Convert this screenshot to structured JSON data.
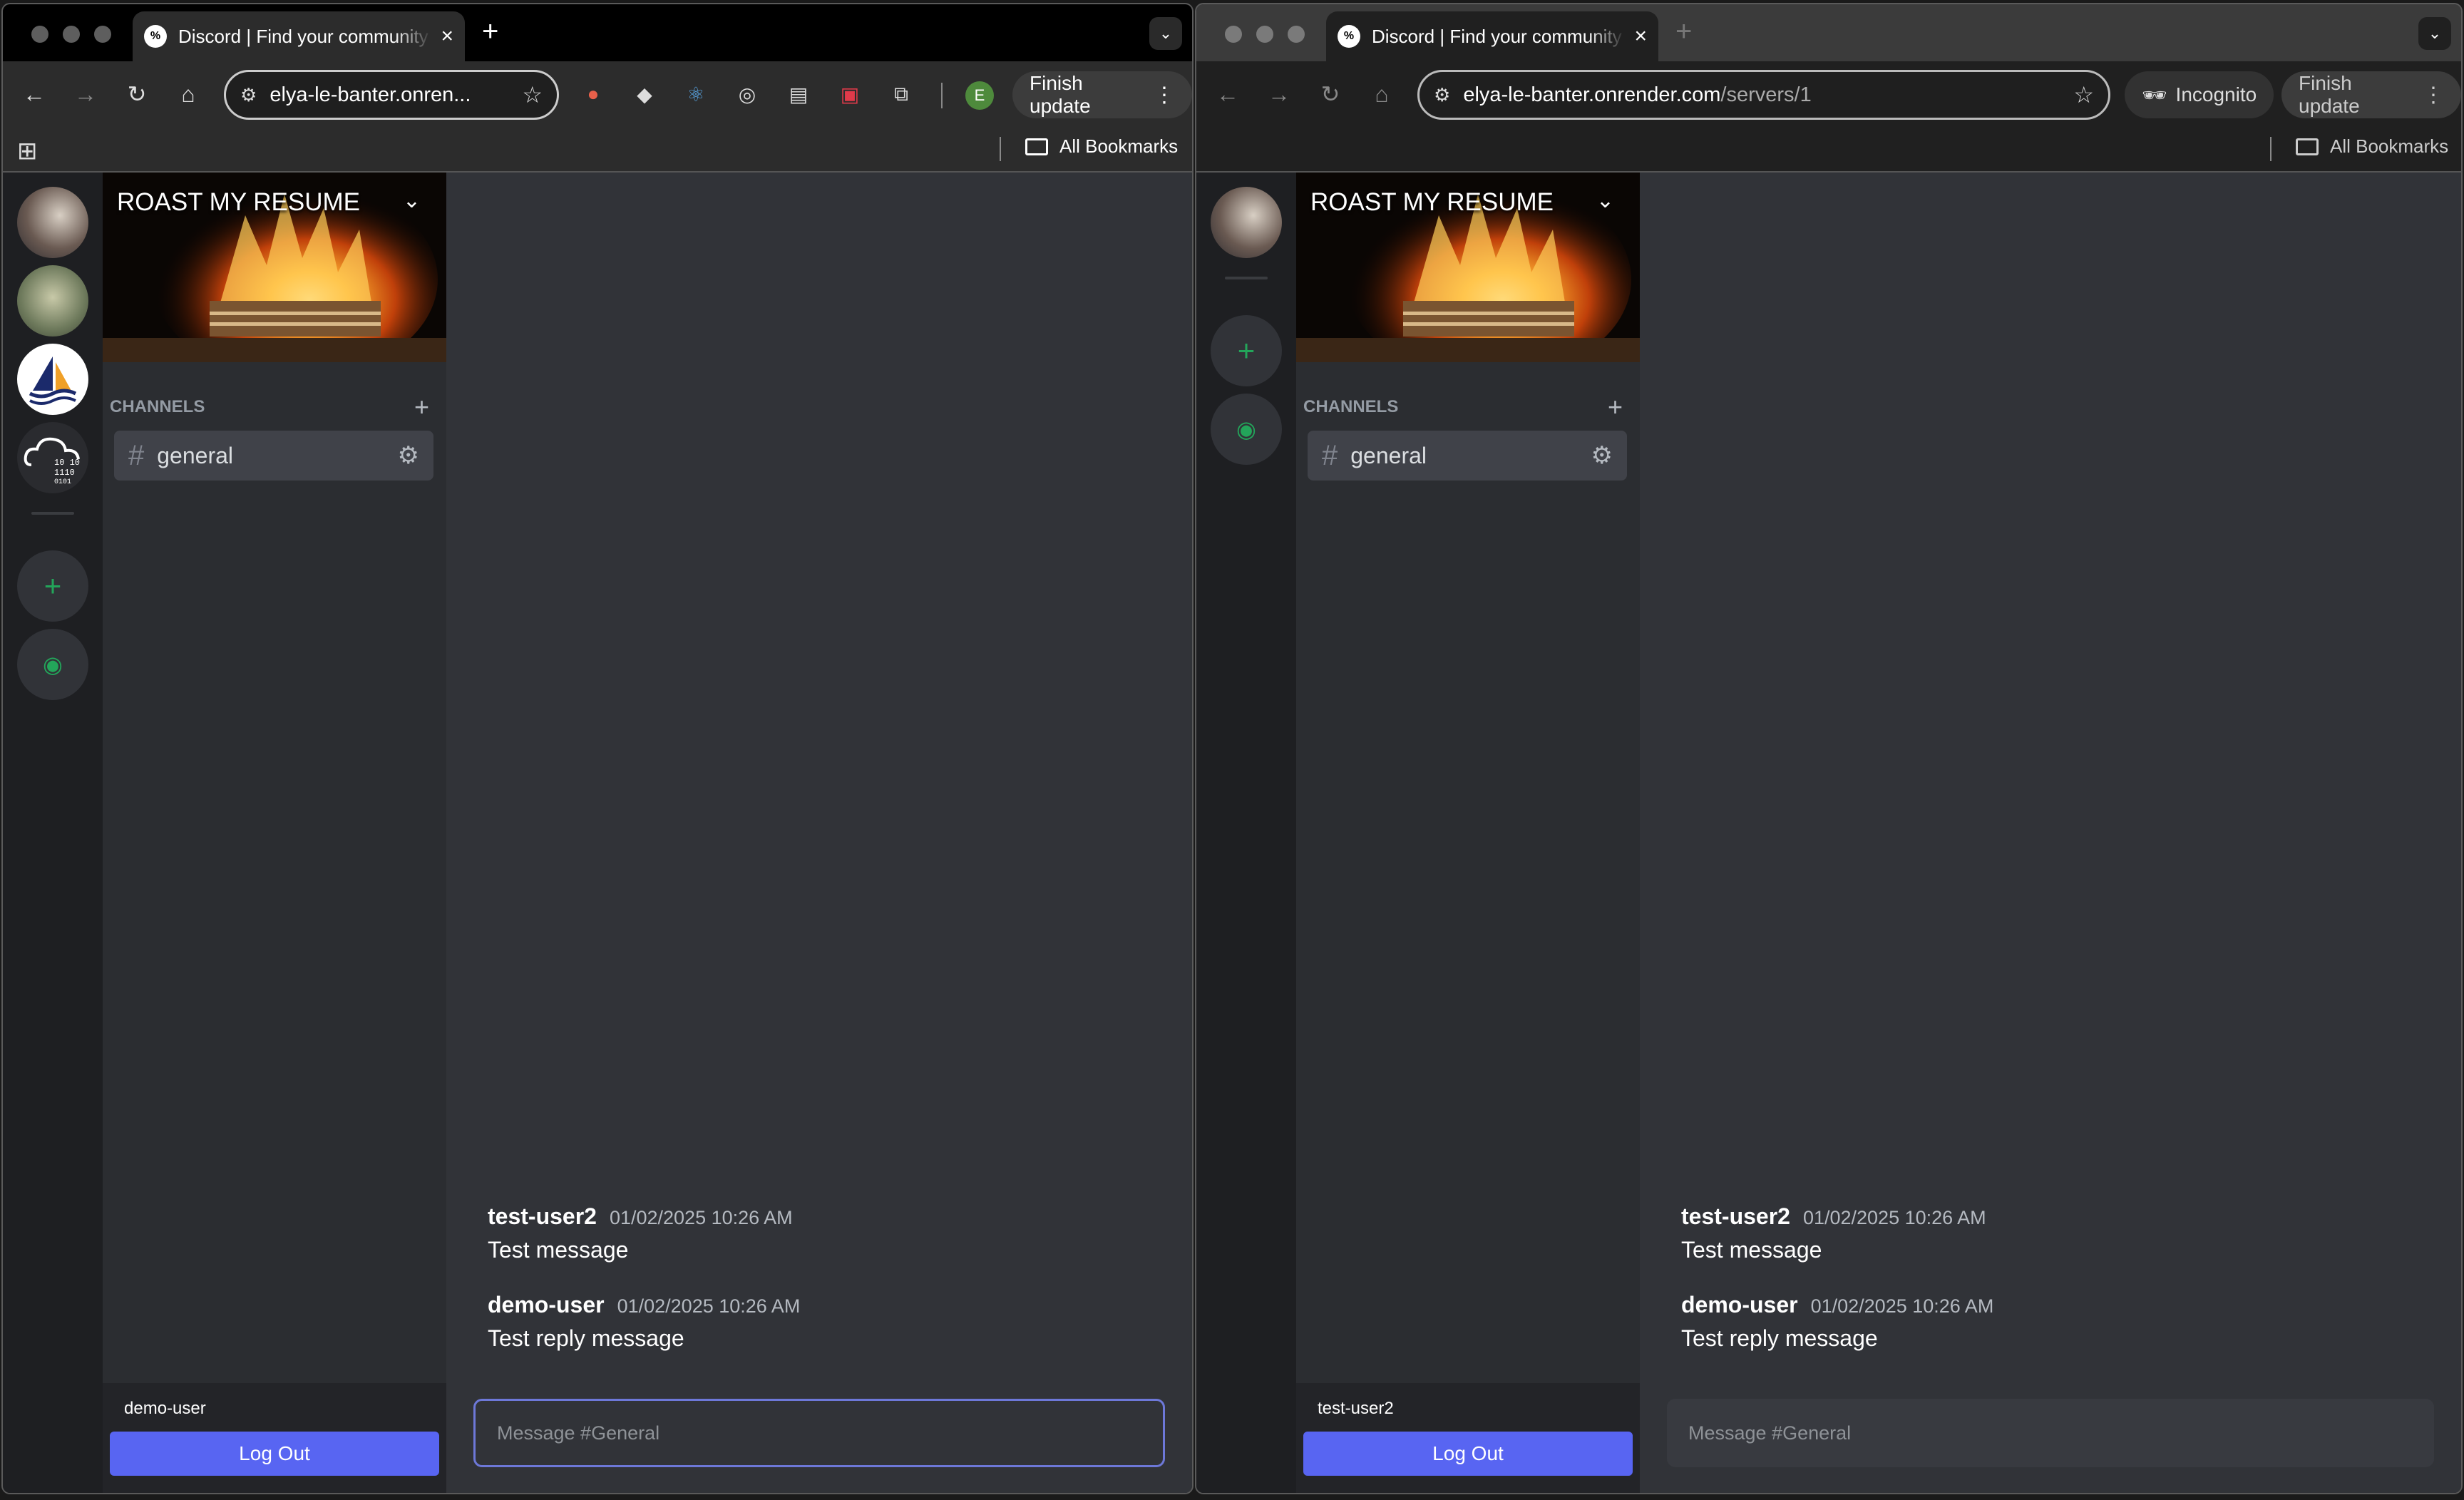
{
  "window_a": {
    "tab": {
      "favicon": "discord-favicon",
      "title": "Discord | Find your community",
      "close": "×"
    },
    "omnibox": {
      "url": "elya-le-banter.onrender.com/servers/1",
      "url_shown": "elya-le-banter.onren...",
      "path": ""
    },
    "profile_initial": "E",
    "finish_update": "Finish update",
    "all_bookmarks": "All Bookmarks",
    "server": {
      "name": "ROAST MY RESUME",
      "channels_label": "CHANNELS",
      "channel": "general"
    },
    "user": {
      "name": "demo-user",
      "logout": "Log Out"
    },
    "messages": [
      {
        "author": "test-user2",
        "time": "01/02/2025 10:26 AM",
        "text": "Test message"
      },
      {
        "author": "demo-user",
        "time": "01/02/2025 10:26 AM",
        "text": "Test reply message"
      }
    ],
    "composer_placeholder": "Message #General"
  },
  "window_b": {
    "tab": {
      "favicon": "discord-favicon",
      "title": "Discord | Find your community",
      "close": "×"
    },
    "omnibox": {
      "url_host": "elya-le-banter.onrender.com",
      "path": "/servers/1"
    },
    "incognito": "Incognito",
    "finish_update": "Finish update",
    "all_bookmarks": "All Bookmarks",
    "server": {
      "name": "ROAST MY RESUME",
      "channels_label": "CHANNELS",
      "channel": "general"
    },
    "user": {
      "name": "test-user2",
      "logout": "Log Out"
    },
    "messages": [
      {
        "author": "test-user2",
        "time": "01/02/2025 10:26 AM",
        "text": "Test message"
      },
      {
        "author": "demo-user",
        "time": "01/02/2025 10:26 AM",
        "text": "Test reply message"
      }
    ],
    "composer_placeholder": "Message #General"
  },
  "colors": {
    "blurple": "#5865f2",
    "green": "#23a55a",
    "chat_bg": "#313338",
    "channel_bg": "#2b2d31",
    "rail_bg": "#1e1f22"
  }
}
